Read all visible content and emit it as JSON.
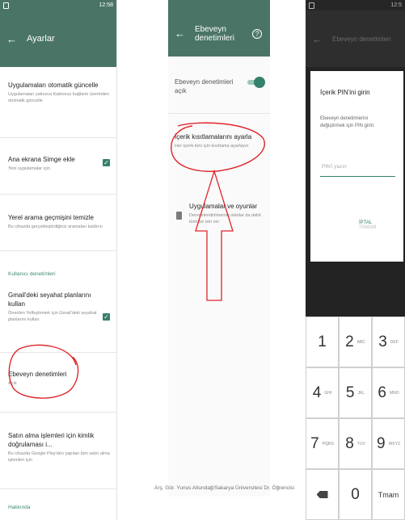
{
  "panel1": {
    "status_time": "12:58",
    "title": "Ayarlar",
    "prefs": [
      {
        "title": "Uygulamaları otomatik güncelle",
        "summary": "Uygulamaları yalnızca Kablosuz bağlantı üzerinden otomatik güncelle"
      },
      {
        "title": "Ana ekrana Simge ekle",
        "summary": "Yeni uygulamalar için"
      },
      {
        "title": "Yerel arama geçmişini temizle",
        "summary": "Bu cihazda gerçekleştirdiğiniz aramaları kaldırın"
      },
      {
        "title": "Gmail'deki seyahat planlarını kullan",
        "summary": "Önerilen Yolfeştirmek için Gmail'deki seyahat planlarını kullan"
      },
      {
        "title": "Ebeveyn denetimleri",
        "summary": "Açık"
      },
      {
        "title": "Satın alma işlemleri için kimlik doğrulaması i...",
        "summary": "Bu cihazda Google Play'den yapılan tüm satın alma işlemleri için"
      }
    ],
    "category_user": "Kullanıcı denetimleri",
    "category_about": "Hakkında"
  },
  "panel2": {
    "title": "Ebeveyn denetimleri",
    "toggle_label": "Ebeveyn denetimleri açık",
    "content_title": "İçerik kısıtlamalarını ayarla",
    "content_summary": "Her içerik türü için kısıtlama ayarlayın",
    "apps_title": "Uygulamalar ve oyunlar",
    "apps_summary": "Derecelendirilmemiş olanlar da dahil tümüne izin ver"
  },
  "panel3": {
    "status_time": "12:5",
    "appbar_title": "Ebeveyn denetimleri",
    "dialog_title": "İçerik PIN'ini girin",
    "dialog_body": "Ebeveyn denetimlerini değiştirmek için PIN girin:",
    "pin_placeholder": "PIN'i yazın",
    "cancel_label": "İPTAL",
    "ok_label": "TAMAM",
    "keys": [
      {
        "n": "1",
        "l": ""
      },
      {
        "n": "2",
        "l": "ABC"
      },
      {
        "n": "3",
        "l": "DEF"
      },
      {
        "n": "4",
        "l": "GHI"
      },
      {
        "n": "5",
        "l": "JKL"
      },
      {
        "n": "6",
        "l": "MNO"
      },
      {
        "n": "7",
        "l": "PQRS"
      },
      {
        "n": "8",
        "l": "TUV"
      },
      {
        "n": "9",
        "l": "WXYZ"
      },
      {
        "n": "",
        "l": ""
      },
      {
        "n": "0",
        "l": ""
      },
      {
        "n": "",
        "l": ""
      }
    ],
    "done_label": "Tmam"
  },
  "credit": "Arş. Gör. Yunus Altundağ/Sakarya Üniversitesi Dr. Öğrencisi",
  "colors": {
    "primary": "#4a7566",
    "accent": "#35806c",
    "annotation": "#e0262b"
  }
}
